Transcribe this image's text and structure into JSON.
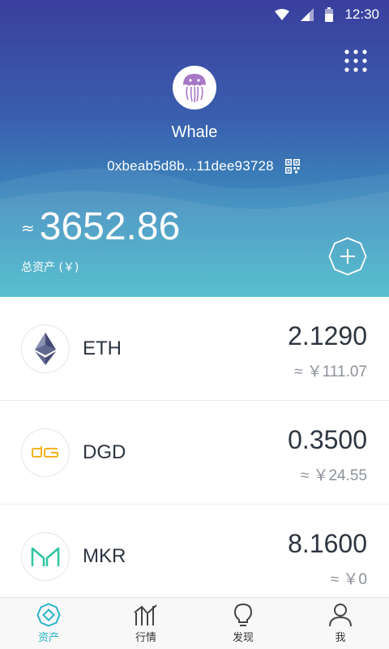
{
  "status_bar": {
    "time": "12:30"
  },
  "wallet": {
    "name": "Whale",
    "address": "0xbeab5d8b...11dee93728",
    "approx_symbol": "≈",
    "total_value": "3652.86",
    "total_label": "总资产 (￥)"
  },
  "tokens": [
    {
      "symbol": "ETH",
      "amount": "2.1290",
      "fiat": "≈ ￥111.07",
      "icon": "ethereum-icon"
    },
    {
      "symbol": "DGD",
      "amount": "0.3500",
      "fiat": "≈ ￥24.55",
      "icon": "digixdao-icon"
    },
    {
      "symbol": "MKR",
      "amount": "8.1600",
      "fiat": "≈ ￥0",
      "icon": "maker-icon"
    }
  ],
  "nav": {
    "items": [
      {
        "label": "资产",
        "icon": "assets-icon",
        "active": true
      },
      {
        "label": "行情",
        "icon": "market-chart-icon",
        "active": false
      },
      {
        "label": "发现",
        "icon": "lightbulb-icon",
        "active": false
      },
      {
        "label": "我",
        "icon": "person-icon",
        "active": false
      }
    ]
  },
  "colors": {
    "header_top": "#3a3f9e",
    "header_bottom": "#3fb7c8",
    "accent": "#2ab4c6",
    "text_dark": "#2d3540",
    "text_muted": "#8d9299"
  }
}
